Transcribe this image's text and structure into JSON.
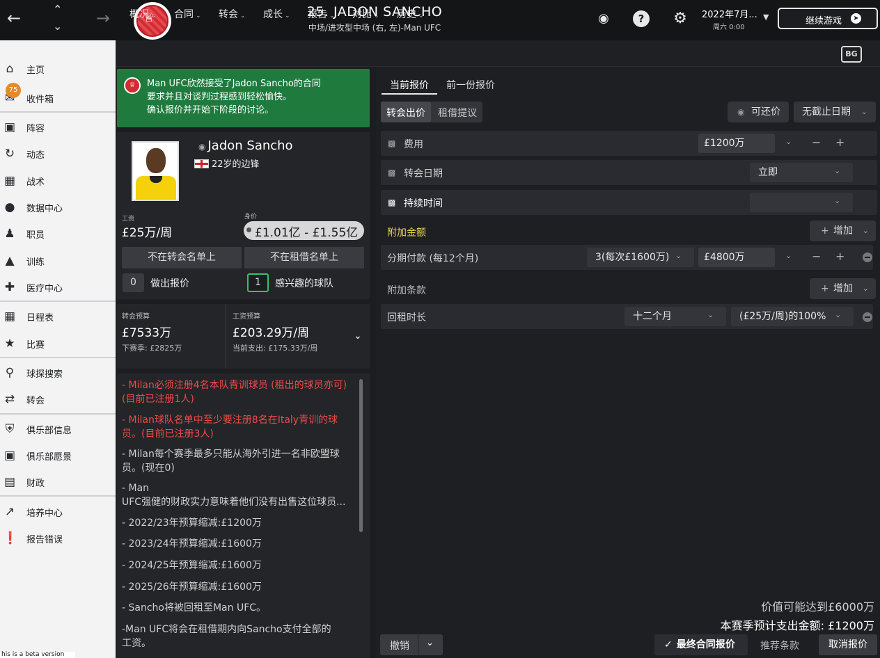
{
  "header": {
    "title": "25. JADON SANCHO",
    "subtitle": "中场/进攻型中场 (右, 左)-Man UFC",
    "date": "2022年7月...",
    "day": "周六 0:00",
    "continue_label": "继续游戏"
  },
  "tabs": [
    "概况",
    "合同",
    "转会",
    "成长",
    "报告",
    "对比",
    "历史"
  ],
  "bg_icon": "BG",
  "sidebar": {
    "inbox_badge": "75",
    "items": [
      "主页",
      "收件箱",
      "阵容",
      "动态",
      "战术",
      "数据中心",
      "职员",
      "训练",
      "医疗中心",
      "日程表",
      "比赛",
      "球探搜索",
      "转会",
      "俱乐部信息",
      "俱乐部愿景",
      "财政",
      "培养中心",
      "报告错误"
    ]
  },
  "notice": {
    "line1": "Man UFC欣然接受了Jadon Sancho的合同",
    "line2": "要求并且对谈判过程感到轻松愉快。",
    "line3": "确认报价并开始下阶段的讨论。"
  },
  "player": {
    "name": "Jadon Sancho",
    "age_pos": "22岁的边锋",
    "wage_label": "工资",
    "wage": "£25万/周",
    "value_label": "身价",
    "value": "£1.01亿 - £1.55亿",
    "transfer_list": "不在转会名单上",
    "loan_list": "不在租借名单上",
    "offers_count": "0",
    "offers_label": "做出报价",
    "interested_count": "1",
    "interested_label": "感兴趣的球队"
  },
  "budget": {
    "transfer_label": "转会预算",
    "transfer": "£7533万",
    "next_season": "下赛季: £2825万",
    "wage_label": "工资预算",
    "wage": "£203.29万/周",
    "current": "当前支出: £175.33万/周"
  },
  "rules": [
    "- Milan必须注册4名本队青训球员 (租出的球员亦可)(目前已注册1人)",
    "- Milan球队名单中至少要注册8名在Italy青训的球员。(目前已注册3人)",
    "- Milan每个赛季最多只能从海外引进一名非欧盟球员。(现在0)",
    "- Man",
    "UFC强健的财政实力意味着他们没有出售这位球员...",
    "- 2022/23年预算缩减:£1200万",
    "- 2023/24年预算缩减:£1600万",
    "- 2024/25年预算缩减:£1600万",
    "- 2025/26年预算缩减:£1600万",
    "- Sancho将被回租至Man UFC。",
    "-Man UFC将会在租借期内向Sancho支付全部的",
    "工资。"
  ],
  "offer": {
    "tab_current": "当前报价",
    "tab_previous": "前一份报价",
    "seg_transfer": "转会出价",
    "seg_loan": "租借提议",
    "negotiable": "可还价",
    "no_deadline": "无截止日期",
    "fee_label": "费用",
    "fee_value": "£1200万",
    "date_label": "转会日期",
    "date_value": "立即",
    "duration_label": "持续时间",
    "extra_amount": "附加金额",
    "add": "增加",
    "installments_label": "分期付款 (每12个月)",
    "installments_value": "3(每次£1600万)",
    "installments_amount": "£4800万",
    "extra_clauses": "附加条款",
    "loanback_label": "回租时长",
    "loanback_duration": "十二个月",
    "loanback_wage": "(£25万/周)的100%",
    "potential": "价值可能达到£6000万",
    "season_spend": "本赛季预计支出金额: £1200万",
    "undo": "撤销",
    "final": "最终合同报价",
    "recommend": "推荐条款",
    "cancel": "取消报价"
  },
  "beta": "his is a beta version",
  "colors": {
    "notice_green": "#1f7a3e",
    "accent_red": "#ee4a4a",
    "gold": "#e6d84a"
  }
}
